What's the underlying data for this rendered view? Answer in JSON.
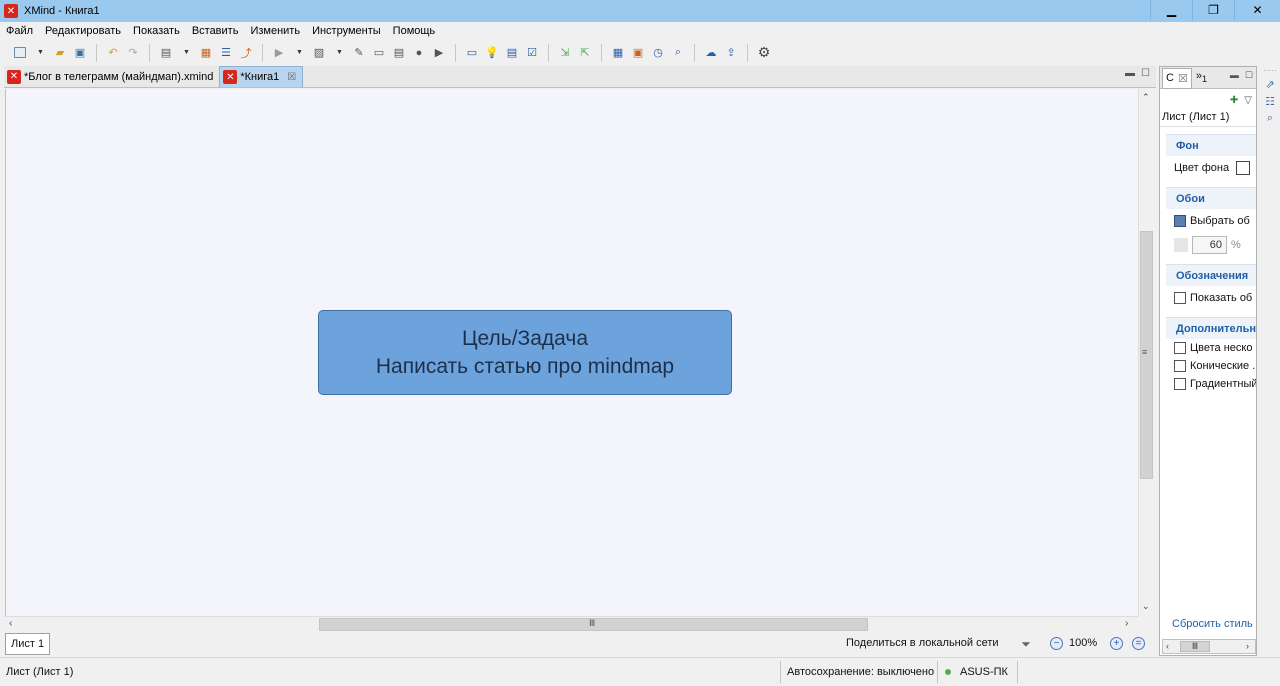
{
  "window": {
    "title": "XMind - Книга1",
    "minimize": "▁",
    "maximize": "❐",
    "close": "✕"
  },
  "menu": [
    "Файл",
    "Редактировать",
    "Показать",
    "Вставить",
    "Изменить",
    "Инструменты",
    "Помощь"
  ],
  "editor": {
    "tabs": [
      {
        "label": "*Блог в телеграмм (майндмап).xmind",
        "active": false
      },
      {
        "label": "*Книга1",
        "active": true
      }
    ],
    "central_topic": {
      "line1": "Цель/Задача",
      "line2": "Написать статью про mindmap"
    },
    "sheet_tab": "Лист 1",
    "share_label": "Поделиться в локальной сети",
    "zoom": "100%"
  },
  "properties": {
    "tab_label": "С",
    "tab_overflow": "»",
    "tab_overflow_count": "1",
    "sheet_name": "Лист (Лист 1)",
    "sections": {
      "background": "Фон",
      "background_color_label": "Цвет фона",
      "wallpaper": "Обои",
      "choose_wallpaper": "Выбрать об",
      "opacity": "60",
      "opacity_unit": "%",
      "legend": "Обозначения",
      "show_legend": "Показать об",
      "advanced": "Дополнительно",
      "multi_colors": "Цвета неско",
      "tapered": "Конические .",
      "gradient": "Градиентный"
    },
    "reset_style": "Сбросить стиль"
  },
  "status": {
    "sheet": "Лист (Лист 1)",
    "autosave": "Автосохранение: выключено",
    "host": "ASUS-ПК"
  },
  "colors": {
    "titlebar": "#99c9ef",
    "topic_fill": "#6da3dc",
    "topic_border": "#3f6fa8",
    "canvas": "#f4f5fa",
    "accent": "#1f5fa8"
  }
}
